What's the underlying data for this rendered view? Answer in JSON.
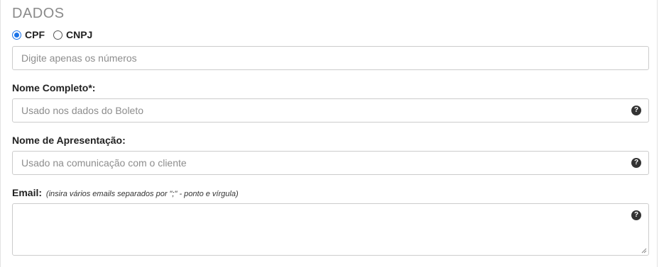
{
  "section": {
    "title": "DADOS"
  },
  "doc_type": {
    "options": [
      {
        "label": "CPF",
        "checked": true
      },
      {
        "label": "CNPJ",
        "checked": false
      }
    ]
  },
  "document_input": {
    "placeholder": "Digite apenas os números",
    "value": ""
  },
  "full_name": {
    "label": "Nome Completo*:",
    "placeholder": "Usado nos dados do Boleto",
    "value": "",
    "help_icon": "question-circle-icon"
  },
  "display_name": {
    "label": "Nome de Apresentação:",
    "placeholder": "Usado na comunicação com o cliente",
    "value": "",
    "help_icon": "question-circle-icon"
  },
  "email": {
    "label": "Email:",
    "hint": "(insira vários emails separados por \";\" - ponto e vírgula)",
    "value": "",
    "help_icon": "question-circle-icon"
  },
  "colors": {
    "radio_accent": "#1a73e8",
    "title": "#8a8a8a",
    "border": "#cccccc",
    "help_icon_bg": "#333333"
  }
}
